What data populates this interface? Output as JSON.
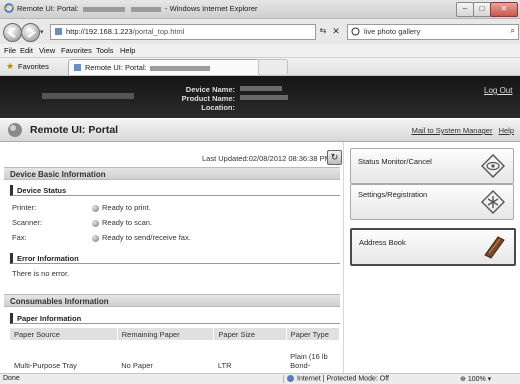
{
  "window": {
    "title_prefix": "Remote UI: Portal:",
    "title_suffix": "- Windows Internet Explorer",
    "min": "–",
    "max": "□",
    "close": "✕"
  },
  "addressbar": {
    "url_host": "http://192.168.1.223",
    "url_path": "/portal_top.html",
    "search_value": "live photo gallery",
    "go_icon": "⇆",
    "stop_icon": "✕",
    "search_icon": "⌕",
    "dropdown_icon": "▾"
  },
  "menu": [
    "File",
    "Edit",
    "View",
    "Favorites",
    "Tools",
    "Help"
  ],
  "favorites": {
    "label": "Favorites",
    "tab_label": "Remote UI: Portal:"
  },
  "banner": {
    "labels": [
      "Device Name:",
      "Product Name:",
      "Location:"
    ],
    "logout": "Log Out"
  },
  "portal": {
    "title": "Remote UI: Portal",
    "mail_link": "Mail to System Manager",
    "help_link": "Help"
  },
  "content": {
    "last_updated": "Last Updated:02/08/2012 08:36:38 PM",
    "refresh_icon": "↻",
    "device_basic_title": "Device Basic Information",
    "device_status_title": "Device Status",
    "status": [
      {
        "label": "Printer:",
        "value": "Ready to print."
      },
      {
        "label": "Scanner:",
        "value": "Ready to scan."
      },
      {
        "label": "Fax:",
        "value": "Ready to send/receive fax."
      }
    ],
    "error_title": "Error Information",
    "error_text": "There is no error.",
    "consumables_title": "Consumables Information",
    "paper_title": "Paper Information",
    "paper_headers": [
      "Paper Source",
      "Remaining Paper",
      "Paper Size",
      "Paper Type"
    ],
    "paper_rows": [
      {
        "source": "Multi-Purpose Tray",
        "remaining": "No Paper",
        "size": "LTR",
        "type": "Plain (16 lb Bond-"
      }
    ]
  },
  "sidebar": {
    "buttons": [
      {
        "label": "Status Monitor/Cancel",
        "icon": "status-monitor-icon"
      },
      {
        "label": "Settings/Registration",
        "icon": "settings-icon"
      },
      {
        "label": "Address Book",
        "icon": "address-book-icon"
      }
    ]
  },
  "statusbar": {
    "done": "Done",
    "zone": "Internet | Protected Mode: Off",
    "zoom": "100%"
  }
}
